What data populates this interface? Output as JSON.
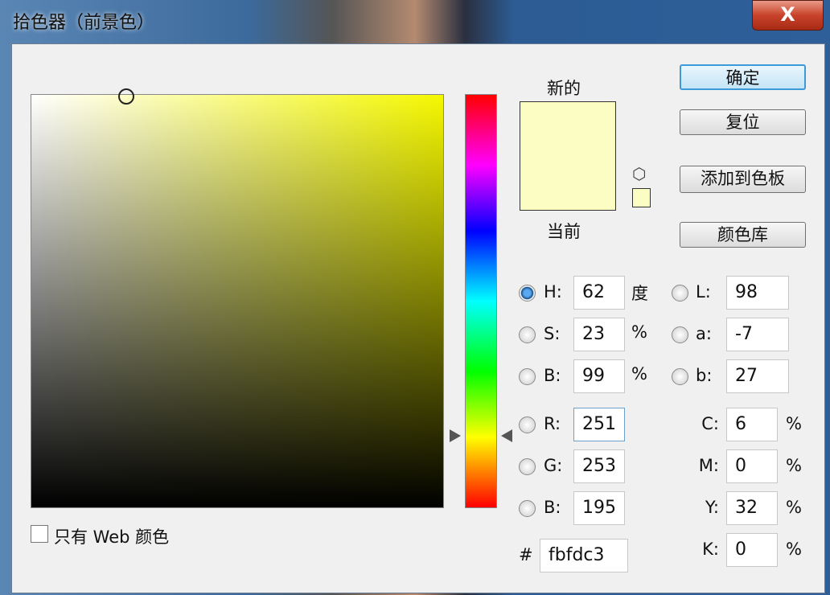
{
  "window": {
    "title": "拾色器（前景色）",
    "close": "X"
  },
  "swatch": {
    "new_label": "新的",
    "current_label": "当前",
    "new_color": "#fbfdc3",
    "current_color": "#fbfdc3"
  },
  "buttons": {
    "ok": "确定",
    "reset": "复位",
    "add_swatch": "添加到色板",
    "libraries": "颜色库"
  },
  "hsb": [
    {
      "label": "H:",
      "value": "62",
      "unit": "度",
      "selected": true
    },
    {
      "label": "S:",
      "value": "23",
      "unit": "%"
    },
    {
      "label": "B:",
      "value": "99",
      "unit": "%"
    }
  ],
  "rgb": [
    {
      "label": "R:",
      "value": "251"
    },
    {
      "label": "G:",
      "value": "253"
    },
    {
      "label": "B:",
      "value": "195"
    }
  ],
  "lab": [
    {
      "label": "L:",
      "value": "98"
    },
    {
      "label": "a:",
      "value": "-7"
    },
    {
      "label": "b:",
      "value": "27"
    }
  ],
  "cmyk": [
    {
      "label": "C:",
      "value": "6",
      "unit": "%"
    },
    {
      "label": "M:",
      "value": "0",
      "unit": "%"
    },
    {
      "label": "Y:",
      "value": "32",
      "unit": "%"
    },
    {
      "label": "K:",
      "value": "0",
      "unit": "%"
    }
  ],
  "hex": {
    "label": "#",
    "value": "fbfdc3"
  },
  "web_only": {
    "label": "只有 Web 颜色",
    "checked": false
  }
}
